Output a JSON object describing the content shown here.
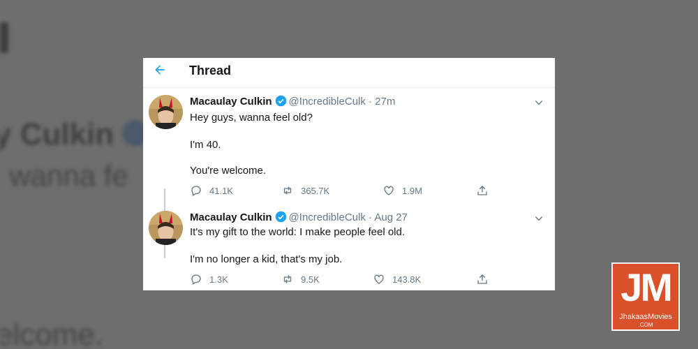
{
  "background": {
    "name_fragment": "y Culkin",
    "text_fragment": ", wanna fe",
    "text_fragment_2": "elcome."
  },
  "header": {
    "title": "Thread",
    "back_icon": "arrow-left-icon"
  },
  "tweets": [
    {
      "name": "Macaulay Culkin",
      "handle": "@IncredibleCulk",
      "separator": "·",
      "time": "27m",
      "lines": [
        "Hey guys, wanna feel old?",
        "I'm 40.",
        "You're welcome."
      ],
      "replies": "41.1K",
      "retweets": "365.7K",
      "likes": "1.9M"
    },
    {
      "name": "Macaulay Culkin",
      "handle": "@IncredibleCulk",
      "separator": "·",
      "time": "Aug 27",
      "lines": [
        "It's my gift to the world: I make people feel old.",
        "I'm no longer a kid, that's my job."
      ],
      "replies": "1.3K",
      "retweets": "9.5K",
      "likes": "143.8K"
    }
  ],
  "watermark": {
    "letters": "JM",
    "name": "JhakaasMovies",
    "suffix": ".COM"
  },
  "colors": {
    "accent": "#1da1f2",
    "text": "#14171a",
    "secondary": "#657786",
    "logo": "#d9502b"
  }
}
